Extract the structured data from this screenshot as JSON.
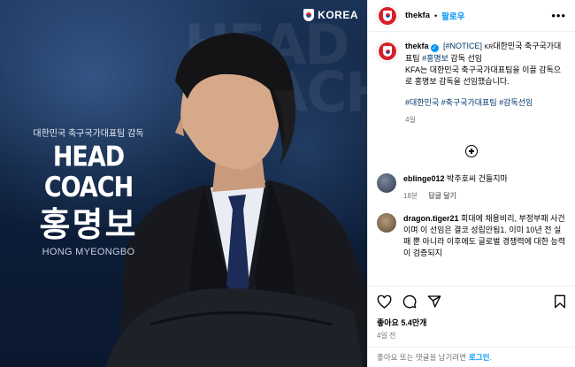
{
  "post": {
    "brand_badge": "KOREA",
    "subtitle": "대한민국 축구국가대표팀 감독",
    "headline": "HEAD COACH",
    "name_kr": "홍명보",
    "name_en": "HONG MYEONGBO",
    "bg_text": "HEAD COACH"
  },
  "header": {
    "username": "thekfa",
    "follow_label": "팔로우",
    "more_icon": "more-options-icon"
  },
  "caption": {
    "username": "thekfa",
    "notice_tag": "[#NOTICE]",
    "flag": "KR",
    "text_before_tag": "대한민국 축구국가대표팀 ",
    "tag_name": "#홍명보",
    "text_after_tag": " 감독 선임",
    "body": "KFA는 대한민국 축구국가대표팀을 이끌 감독으로 홍명보 감독을 선임했습니다.",
    "hashtags": [
      "#대한민국",
      "#축구국가대표팀",
      "#감독선임"
    ],
    "time": "4일"
  },
  "comments": [
    {
      "username": "eblinge012",
      "text": "박주호씨 건들지마",
      "time": "18분",
      "reply": "답글 달기"
    },
    {
      "username": "dragon.tiger21",
      "text": "회대에 채용비리, 부정부패 사건이며 이 선임은 결코 성립안됨1. 이미 10년 전 실패 뿐 아니라 이후에도 글로벌 경쟁력에 대한 능력이 검증되지"
    }
  ],
  "likes": "좋아요 5.4만개",
  "posted_ago": "4일 전",
  "login": {
    "prompt": "좋아요 또는 댓글을 남기려면",
    "link": "로그인",
    "suffix": "."
  },
  "colors": {
    "accent": "#0095f6",
    "kfa_red": "#d7212a",
    "tag": "#00376b",
    "muted": "#737373"
  }
}
